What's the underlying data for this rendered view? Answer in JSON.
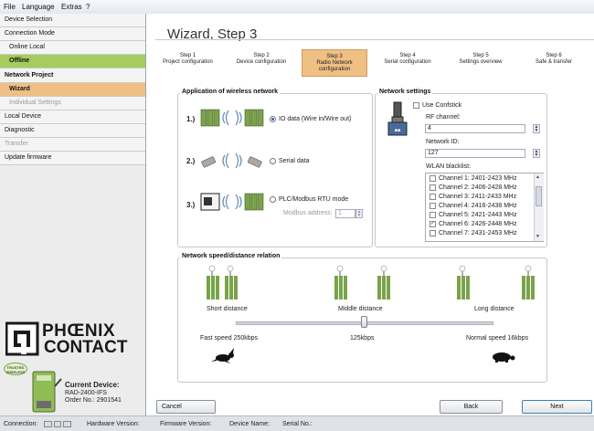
{
  "menu": {
    "file": "File",
    "language": "Language",
    "extras": "Extras",
    "help": "?"
  },
  "sidebar": {
    "items": [
      {
        "label": "Device Selection"
      },
      {
        "label": "Connection Mode"
      },
      {
        "label": "Online Local"
      },
      {
        "label": "Offline"
      },
      {
        "label": "Network Project"
      },
      {
        "label": "Wizard"
      },
      {
        "label": "Individual Settings"
      },
      {
        "label": "Local Device"
      },
      {
        "label": "Diagnostic"
      },
      {
        "label": "Transfer"
      },
      {
        "label": "Update firmware"
      }
    ]
  },
  "logo": {
    "line1": "PHŒNIX",
    "line2": "CONTACT",
    "trusted_badge": "TRUSTED WIRELESS"
  },
  "current_device": {
    "heading": "Current Device:",
    "model": "RAD-2400-IFS",
    "order": "Order No.: 2901541"
  },
  "wizard": {
    "title": "Wizard, Step 3",
    "steps": [
      {
        "line1": "Step 1",
        "line2": "Project configuration",
        "line3": ""
      },
      {
        "line1": "Step 2",
        "line2": "Device configuration",
        "line3": ""
      },
      {
        "line1": "Step 3",
        "line2": "Radio Network",
        "line3": "configuration"
      },
      {
        "line1": "Step 4",
        "line2": "Serial configuration",
        "line3": ""
      },
      {
        "line1": "Step 5",
        "line2": "Settings overview",
        "line3": ""
      },
      {
        "line1": "Step 6",
        "line2": "Safe & transfer",
        "line3": ""
      }
    ]
  },
  "application": {
    "title": "Application of wireless network",
    "options": [
      {
        "num": "1.)",
        "label": "IO data (Wire in/Wire out)",
        "selected": true
      },
      {
        "num": "2.)",
        "label": "Serial data",
        "selected": false
      },
      {
        "num": "3.)",
        "label": "PLC/Modbus RTU mode",
        "selected": false
      }
    ],
    "modbus_label": "Modbus address:",
    "modbus_value": "1"
  },
  "network_settings": {
    "title": "Network settings",
    "use_confstick": "Use Confstick",
    "rf_channel_label": "RF channel:",
    "rf_channel_value": "4",
    "network_id_label": "Network ID:",
    "network_id_value": "127",
    "blacklist_label": "WLAN blacklist:",
    "blacklist": [
      {
        "label": "Channel 1: 2401-2423 MHz",
        "checked": false
      },
      {
        "label": "Channel 2: 2406-2428 MHz",
        "checked": false
      },
      {
        "label": "Channel 3: 2411-2433 MHz",
        "checked": false
      },
      {
        "label": "Channel 4: 2416-2438 MHz",
        "checked": false
      },
      {
        "label": "Channel 5: 2421-2443 MHz",
        "checked": false
      },
      {
        "label": "Channel 6: 2426-2448 MHz",
        "checked": true
      },
      {
        "label": "Channel 7: 2431-2453 MHz",
        "checked": false
      }
    ]
  },
  "speed": {
    "title": "Network speed/distance relation",
    "short": "Short distance",
    "middle": "Middle distance",
    "long": "Long distance",
    "fast": "Fast speed 250kbps",
    "mid_speed": "125kbps",
    "normal": "Normal speed 16kbps",
    "slider_value": 0.5
  },
  "buttons": {
    "cancel": "Cancel",
    "back": "Back",
    "next": "Next"
  },
  "status": {
    "connection": "Connection:",
    "hardware": "Hardware Version:",
    "firmware": "Firmware Version:",
    "device_name": "Device Name:",
    "serial": "Serial No.:"
  },
  "colors": {
    "active_green": "#a5cc5d",
    "active_orange": "#f0bf84",
    "brand_green": "#7aa34a"
  }
}
